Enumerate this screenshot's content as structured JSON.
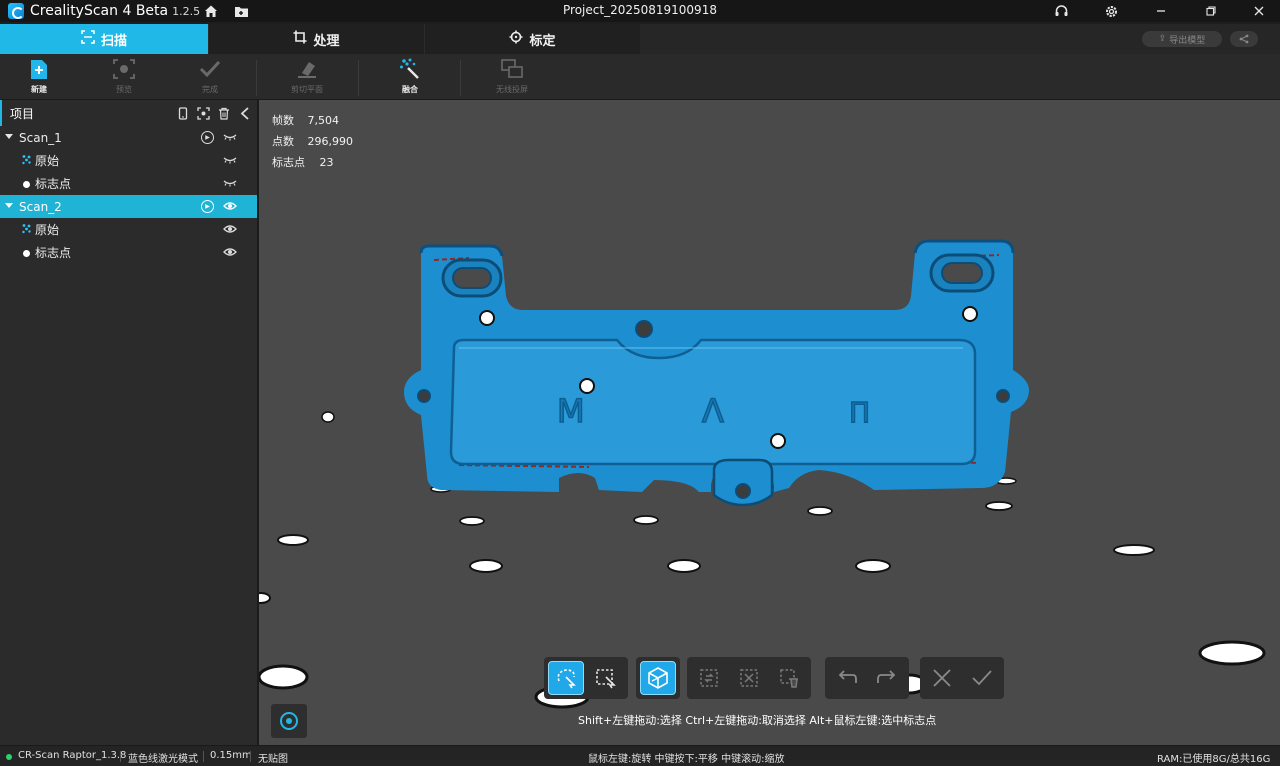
{
  "app": {
    "name": "CrealityScan 4 Beta",
    "version": "1.2.5",
    "project_title": "Project_20250819100918"
  },
  "window_controls": [
    "minimize-icon",
    "restore-icon",
    "close-icon"
  ],
  "tabs": [
    {
      "label": "扫描",
      "icon": "scan-icon",
      "active": true
    },
    {
      "label": "处理",
      "icon": "crop-icon",
      "active": false
    },
    {
      "label": "标定",
      "icon": "target-icon",
      "active": false
    }
  ],
  "header_actions": {
    "export_label": "导出模型"
  },
  "toolbar": {
    "new": "新建",
    "preview": "预览",
    "finish": "完成",
    "cut_plane": "剪切平面",
    "fuse": "融合",
    "wireless_cast": "无线投屏"
  },
  "sidebar": {
    "title": "项目",
    "items": [
      {
        "label": "Scan_1",
        "type": "scan",
        "visible": false,
        "selected": false
      },
      {
        "label": "原始",
        "type": "raw",
        "visible": false,
        "selected": false
      },
      {
        "label": "标志点",
        "type": "marker",
        "visible": false,
        "selected": false
      },
      {
        "label": "Scan_2",
        "type": "scan",
        "visible": true,
        "selected": true
      },
      {
        "label": "原始",
        "type": "raw",
        "visible": true,
        "selected": false
      },
      {
        "label": "标志点",
        "type": "marker",
        "visible": true,
        "selected": false
      }
    ]
  },
  "stats": {
    "frames_label": "帧数",
    "frames_value": "7,504",
    "points_label": "点数",
    "points_value": "296,990",
    "markers_label": "标志点",
    "markers_value": "23"
  },
  "viewport": {
    "model_color": "#1e8fd0",
    "hint": "Shift+左键拖动:选择   Ctrl+左键拖动:取消选择   Alt+鼠标左键:选中标志点",
    "mesh_letters": [
      "M",
      "Λ",
      "Π"
    ]
  },
  "status": {
    "device": "CR-Scan Raptor_1.3.8",
    "mode": "蓝色线激光模式",
    "resolution": "0.15mm",
    "marker_mode": "无贴图",
    "mouse_help": "鼠标左键:旋转   中键按下:平移   中键滚动:缩放",
    "ram": "RAM:已使用8G/总共16G"
  },
  "colors": {
    "accent": "#20b8e6",
    "status_ok": "#29d36b"
  }
}
